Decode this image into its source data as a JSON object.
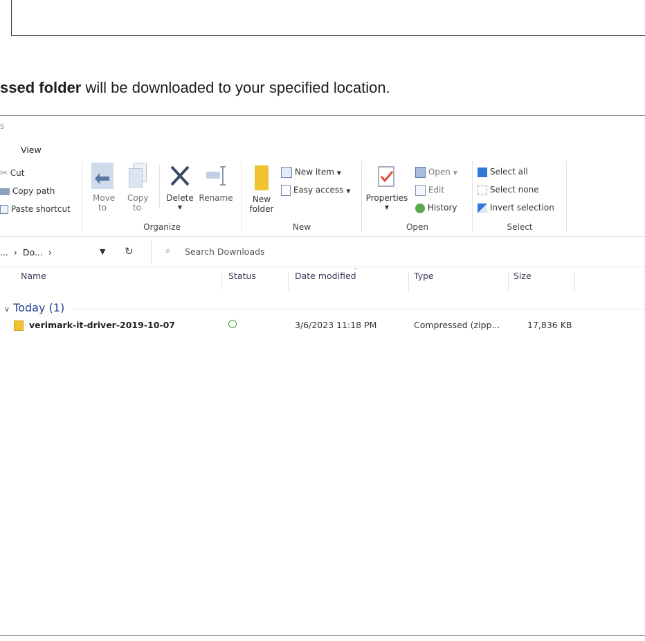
{
  "doc": {
    "bold": "ssed folder",
    "rest": " will be downloaded to your specified location."
  },
  "explorer": {
    "title_fragment": "s",
    "ribbon_tab": "View",
    "clipboard": {
      "cut": "Cut",
      "copy_path": "Copy path",
      "paste_shortcut": "Paste shortcut"
    },
    "organize": {
      "label": "Organize",
      "move_to": "Move to",
      "copy_to": "Copy to",
      "delete": "Delete",
      "rename": "Rename"
    },
    "new": {
      "label": "New",
      "new_folder": "New folder",
      "new_item": "New item",
      "easy_access": "Easy access"
    },
    "open": {
      "label": "Open",
      "properties": "Properties",
      "open": "Open",
      "edit": "Edit",
      "history": "History"
    },
    "select": {
      "label": "Select",
      "select_all": "Select all",
      "select_none": "Select none",
      "invert_selection": "Invert selection"
    },
    "address": {
      "path_prefix": "...",
      "path_segment": "Do...",
      "separator": "›"
    },
    "search": {
      "placeholder": "Search Downloads"
    },
    "columns": {
      "name": "Name",
      "status": "Status",
      "date_modified": "Date modified",
      "type": "Type",
      "size": "Size"
    },
    "group": {
      "label": "Today (1)"
    },
    "files": [
      {
        "name": "verimark-it-driver-2019-10-07",
        "date_modified": "3/6/2023 11:18 PM",
        "type": "Compressed (zipp...",
        "size": "17,836 KB"
      }
    ],
    "colors": {
      "accent": "#1e6fd0",
      "status_ok": "#3a9a3a",
      "group_heading": "#1e3f8e"
    }
  }
}
